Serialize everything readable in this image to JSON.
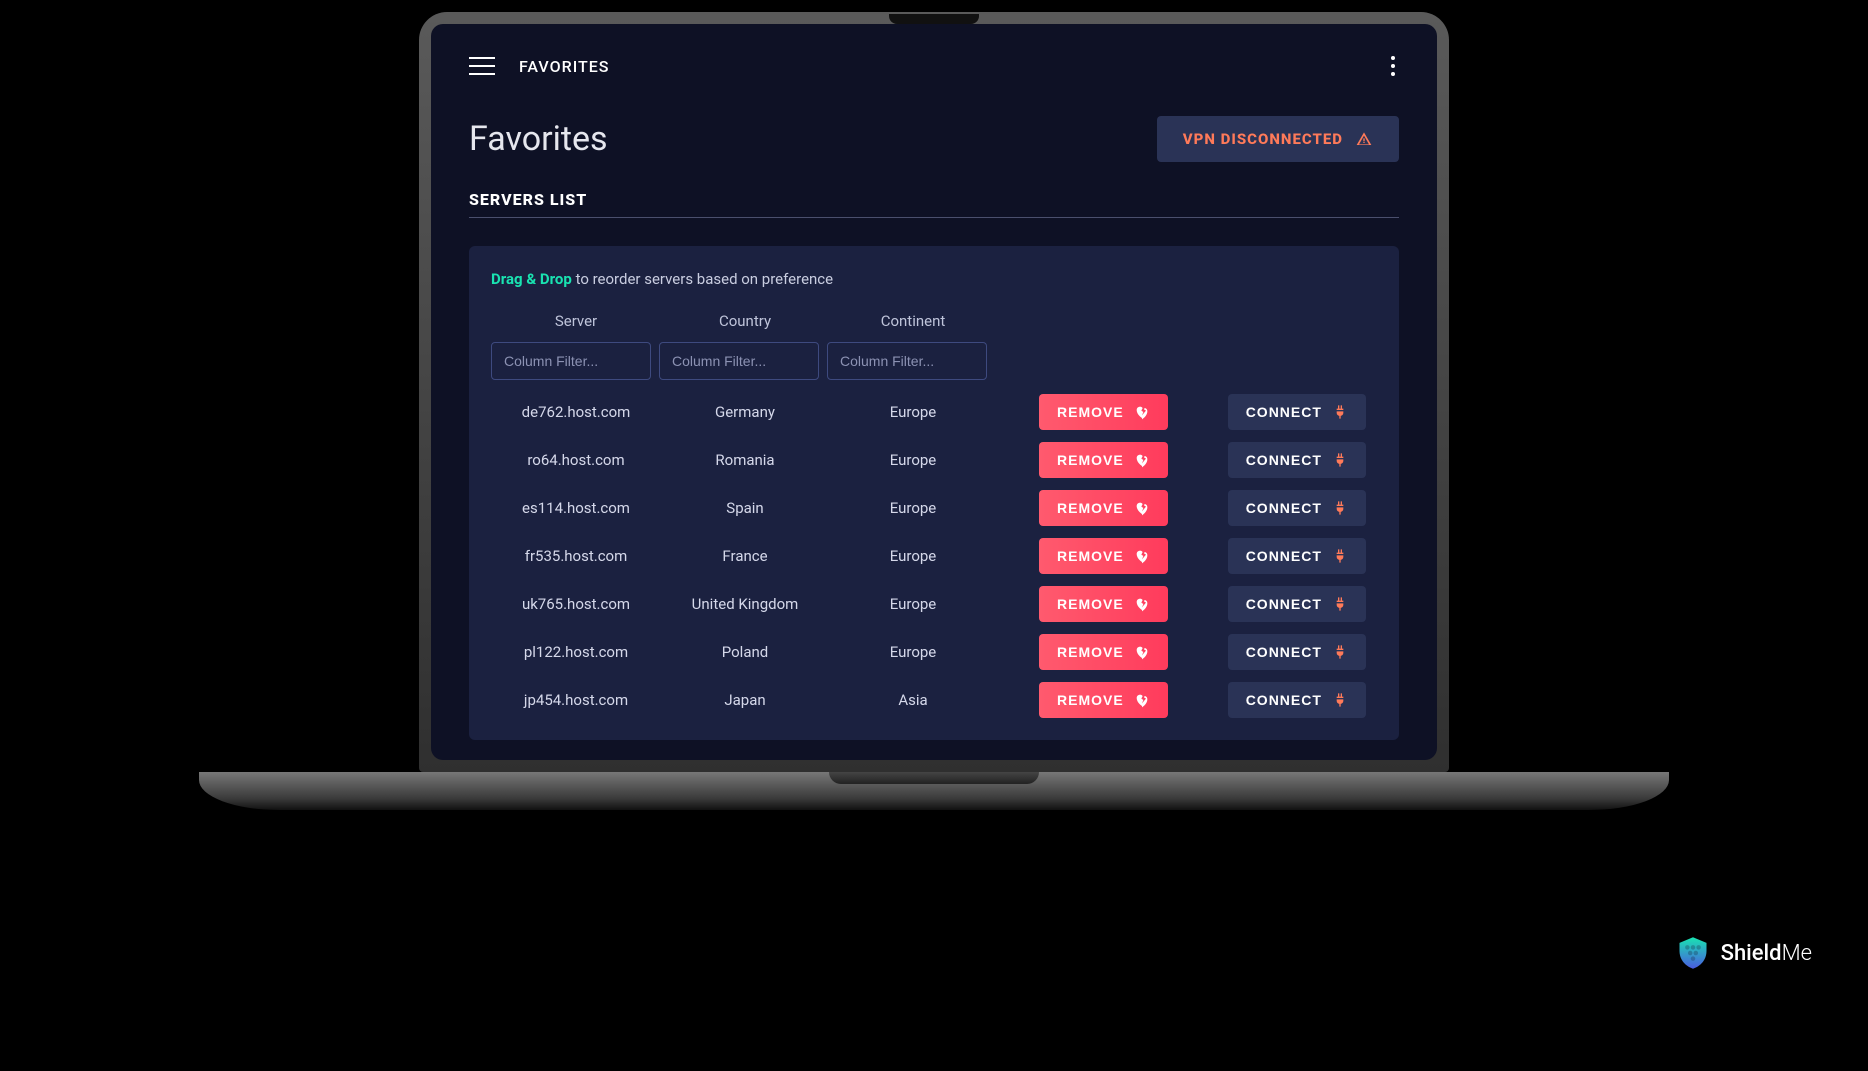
{
  "topbar": {
    "title": "FAVORITES"
  },
  "header": {
    "page_title": "Favorites",
    "vpn_status": "VPN DISCONNECTED"
  },
  "section_label": "SERVERS LIST",
  "hint": {
    "prefix": "Drag & Drop",
    "rest": " to reorder servers based on preference"
  },
  "columns": {
    "server": "Server",
    "country": "Country",
    "continent": "Continent",
    "filter_placeholder": "Column Filter..."
  },
  "buttons": {
    "remove": "REMOVE",
    "connect": "CONNECT"
  },
  "servers": [
    {
      "host": "de762.host.com",
      "country": "Germany",
      "continent": "Europe"
    },
    {
      "host": "ro64.host.com",
      "country": "Romania",
      "continent": "Europe"
    },
    {
      "host": "es114.host.com",
      "country": "Spain",
      "continent": "Europe"
    },
    {
      "host": "fr535.host.com",
      "country": "France",
      "continent": "Europe"
    },
    {
      "host": "uk765.host.com",
      "country": "United Kingdom",
      "continent": "Europe"
    },
    {
      "host": "pl122.host.com",
      "country": "Poland",
      "continent": "Europe"
    },
    {
      "host": "jp454.host.com",
      "country": "Japan",
      "continent": "Asia"
    }
  ],
  "brand": {
    "name_a": "Shield",
    "name_b": "Me"
  }
}
